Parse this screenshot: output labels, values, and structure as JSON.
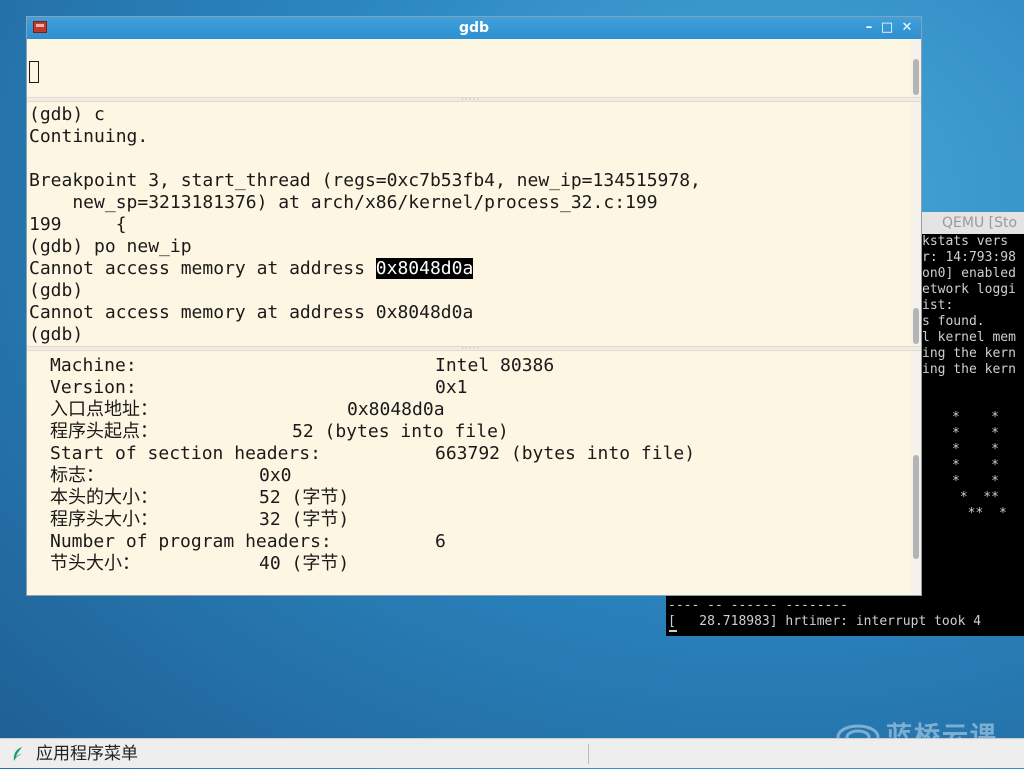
{
  "qemu": {
    "title": "QEMU [Sto",
    "lines": [
      "kstats vers",
      "r: 14:793:98",
      "on0] enabled",
      "etwork loggi",
      "ist:",
      "s found.",
      "l kernel mem",
      "ing the kern",
      "ing the kern",
      "",
      "",
      "*    *",
      "*    *",
      "*    *",
      "*    *",
      "*    *",
      " *  **",
      "  **  *"
    ],
    "bottom_line": "[   28.718983] hrtimer: interrupt took 4",
    "cut_line": "---- -- ------ --------"
  },
  "gdb": {
    "title": "gdb",
    "buttons": {
      "minimize": "–",
      "maximize": "□",
      "close": "✕"
    },
    "console": {
      "lines": [
        "(gdb) c",
        "Continuing.",
        "",
        "Breakpoint 3, start_thread (regs=0xc7b53fb4, new_ip=134515978,",
        "    new_sp=3213181376) at arch/x86/kernel/process_32.c:199",
        "199\t{",
        "(gdb) po new_ip"
      ],
      "error_prefix": "Cannot access memory at address ",
      "error_address": "0x8048d0a",
      "prompt2": "(gdb)",
      "error2": "Cannot access memory at address 0x8048d0a",
      "prompt3": "(gdb)"
    },
    "info": [
      {
        "label": "Machine:",
        "value": "Intel 80386"
      },
      {
        "label": "Version:",
        "value": "0x1"
      },
      {
        "label": "入口点地址：",
        "value": "0x8048d0a"
      },
      {
        "label": "程序头起点：",
        "value": "52 (bytes into file)"
      },
      {
        "label": "Start of section headers:",
        "value": "663792 (bytes into file)"
      },
      {
        "label": "标志：",
        "value": "0x0"
      },
      {
        "label": "本头的大小：",
        "value": "52 (字节)"
      },
      {
        "label": "程序头大小：",
        "value": "32 (字节)"
      },
      {
        "label": "Number of program headers:",
        "value": "6"
      },
      {
        "label": "节头大小：",
        "value": "40 (字节)"
      }
    ]
  },
  "taskbar": {
    "menu_label": "应用程序菜单"
  },
  "watermark": {
    "text": "蓝桥云课"
  },
  "colors": {
    "titlebar": "#2f8fd0",
    "terminal_bg": "#fdf6e3",
    "desktop": "#2b86c0"
  }
}
